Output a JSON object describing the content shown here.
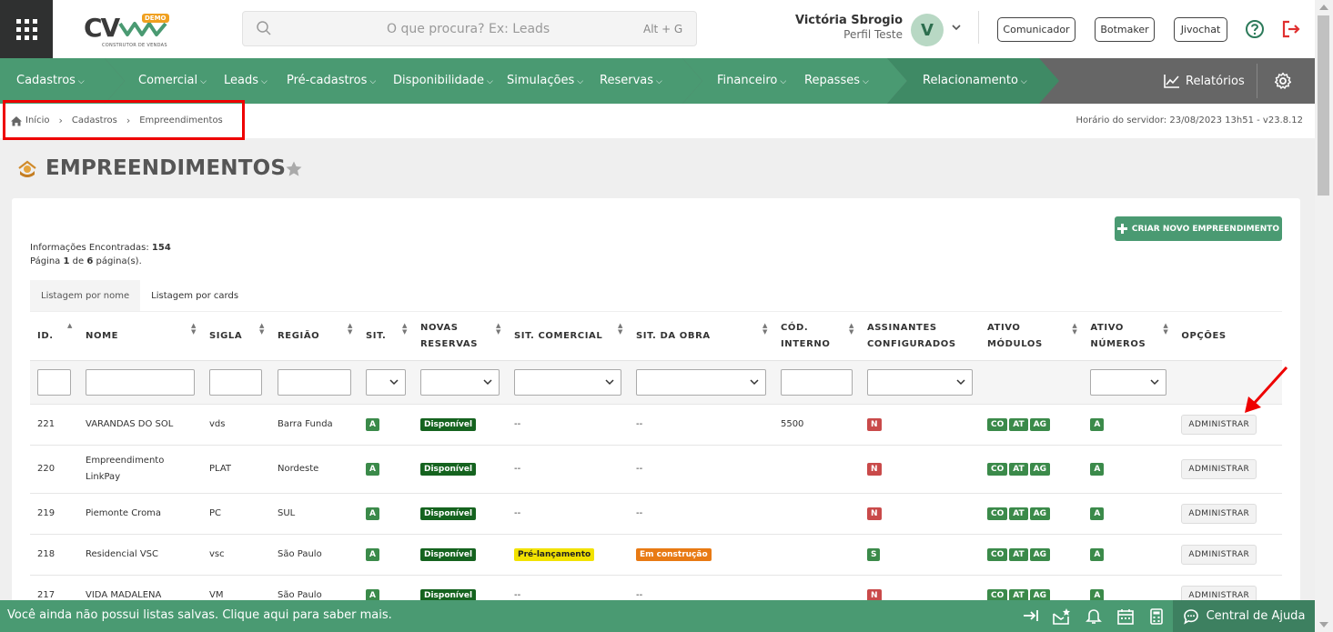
{
  "header": {
    "logo_text": "CV",
    "logo_badge": "DEMO",
    "logo_subtitle": "CONSTRUTOR DE VENDAS",
    "search_placeholder": "O que procura? Ex: Leads",
    "search_shortcut": "Alt + G",
    "user_name": "Victória Sbrogio",
    "user_role": "Perfil Teste",
    "avatar_initial": "V",
    "buttons": [
      "Comunicador",
      "Botmaker",
      "Jivochat"
    ]
  },
  "nav": {
    "items": [
      "Cadastros",
      "Comercial",
      "Leads",
      "Pré-cadastros",
      "Disponibilidade",
      "Simulações",
      "Reservas",
      "Financeiro",
      "Repasses",
      "Relacionamento"
    ],
    "reports": "Relatórios"
  },
  "breadcrumb": [
    "Início",
    "Cadastros",
    "Empreendimentos"
  ],
  "server_time": "Horário do servidor: 23/08/2023 13h51 - v23.8.12",
  "page_title": "EMPREENDIMENTOS",
  "create_button": "CRIAR NOVO EMPREENDIMENTO",
  "info": {
    "found_label": "Informações Encontradas:",
    "found_count": "154",
    "page_prefix": "Página",
    "page_current": "1",
    "page_of": "de",
    "page_total": "6",
    "page_suffix": "página(s)."
  },
  "tabs": [
    "Listagem por nome",
    "Listagem por cards"
  ],
  "table": {
    "columns": [
      "ID.",
      "NOME",
      "SIGLA",
      "REGIÃO",
      "SIT.",
      "NOVAS RESERVAS",
      "SIT. COMERCIAL",
      "SIT. DA OBRA",
      "CÓD. INTERNO",
      "ASSINANTES CONFIGURADOS",
      "ATIVO MÓDULOS",
      "ATIVO NÚMEROS",
      "OPÇÕES"
    ],
    "module_badges": [
      "CO",
      "AT",
      "AG"
    ],
    "action_label": "ADMINISTRAR",
    "rows": [
      {
        "id": "221",
        "nome": "VARANDAS DO SOL",
        "sigla": "vds",
        "regiao": "Barra Funda",
        "sit": "A",
        "novas": "Disponível",
        "comercial": "--",
        "obra": "--",
        "cod": "5500",
        "assin": "N",
        "numeros": "A"
      },
      {
        "id": "220",
        "nome": "Empreendimento LinkPay",
        "sigla": "PLAT",
        "regiao": "Nordeste",
        "sit": "A",
        "novas": "Disponível",
        "comercial": "--",
        "obra": "--",
        "cod": "",
        "assin": "N",
        "numeros": "A"
      },
      {
        "id": "219",
        "nome": "Piemonte Croma",
        "sigla": "PC",
        "regiao": "SUL",
        "sit": "A",
        "novas": "Disponível",
        "comercial": "--",
        "obra": "--",
        "cod": "",
        "assin": "N",
        "numeros": "A"
      },
      {
        "id": "218",
        "nome": "Residencial VSC",
        "sigla": "vsc",
        "regiao": "São Paulo",
        "sit": "A",
        "novas": "Disponível",
        "comercial": "Pré-lançamento",
        "obra": "Em construção",
        "cod": "",
        "assin": "S",
        "numeros": "A"
      },
      {
        "id": "217",
        "nome": "VIDA MADALENA",
        "sigla": "VM",
        "regiao": "São Paulo",
        "sit": "A",
        "novas": "Disponível",
        "comercial": "--",
        "obra": "--",
        "cod": "",
        "assin": "N",
        "numeros": "A"
      }
    ]
  },
  "footer": {
    "message": "Você ainda não possui listas salvas. Clique aqui para saber mais.",
    "help_center": "Central de Ajuda"
  },
  "colors": {
    "primary_green": "#4a9a72",
    "nav_gray": "#666666",
    "available_badge": "#15631f",
    "highlight_red": "#e00000"
  }
}
